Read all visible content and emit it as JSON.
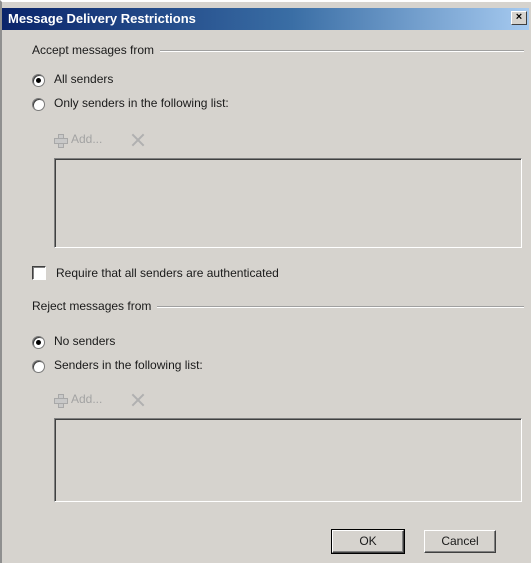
{
  "window": {
    "title": "Message Delivery Restrictions",
    "close_symbol": "×"
  },
  "accept": {
    "group_label": "Accept messages from",
    "options": [
      {
        "label": "All senders",
        "selected": true
      },
      {
        "label": "Only senders in the following list:",
        "selected": false
      }
    ],
    "toolbar": {
      "add_label": "Add...",
      "add_icon": "plus-icon",
      "remove_icon": "x-icon"
    },
    "list_items": []
  },
  "require_auth": {
    "label": "Require that all senders are authenticated",
    "checked": false
  },
  "reject": {
    "group_label": "Reject messages from",
    "options": [
      {
        "label": "No senders",
        "selected": true
      },
      {
        "label": "Senders in the following list:",
        "selected": false
      }
    ],
    "toolbar": {
      "add_label": "Add...",
      "add_icon": "plus-icon",
      "remove_icon": "x-icon"
    },
    "list_items": []
  },
  "buttons": {
    "ok": "OK",
    "cancel": "Cancel"
  },
  "colors": {
    "dialog_bg": "#d6d3ce",
    "title_gradient_start": "#0a246a",
    "title_gradient_end": "#a6caf0",
    "disabled_text": "#a3a3a3"
  }
}
